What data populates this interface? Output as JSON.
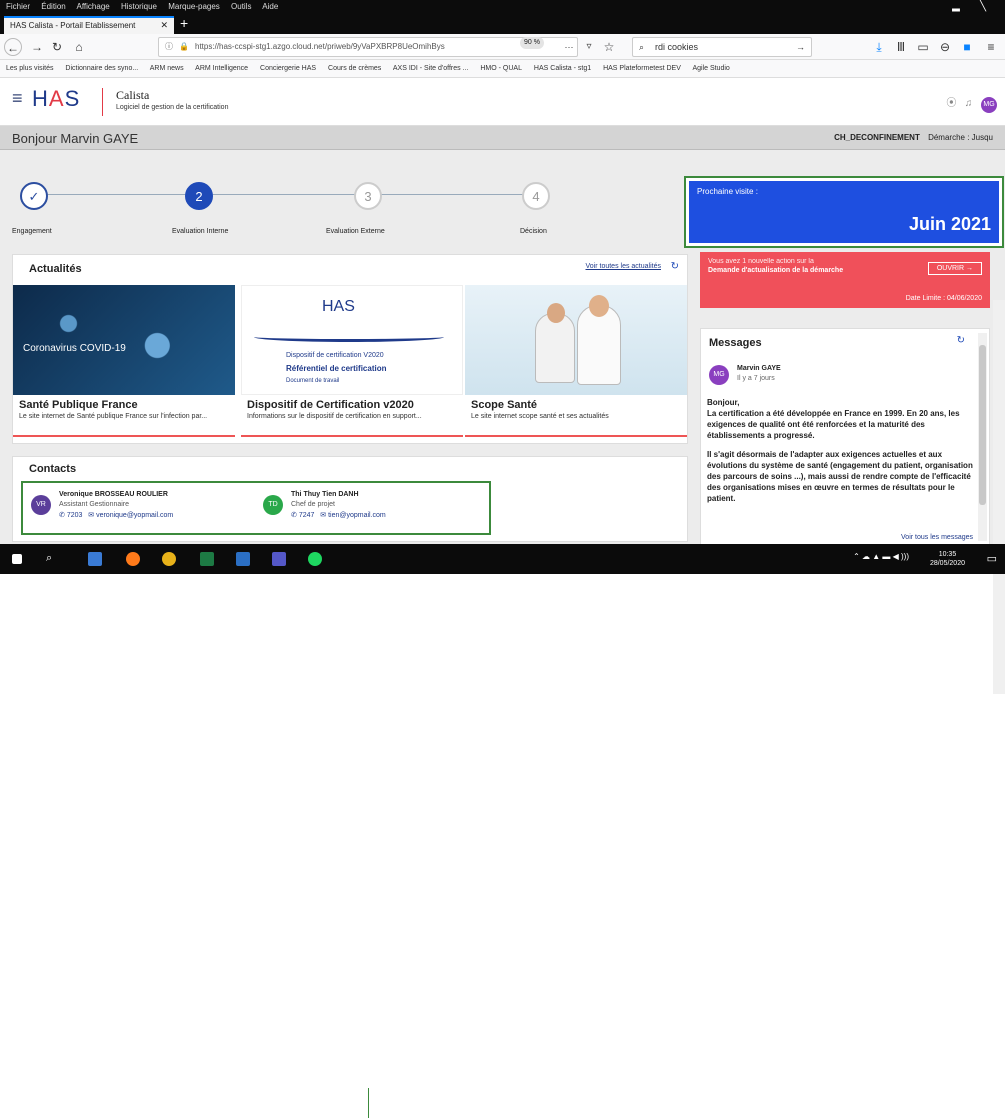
{
  "browser": {
    "menu": [
      "Fichier",
      "Édition",
      "Affichage",
      "Historique",
      "Marque-pages",
      "Outils",
      "Aide"
    ],
    "tab_title": "HAS Calista - Portail Etablissement",
    "tab_close": "✕",
    "new_tab": "+",
    "url": "https://has-ccspi-stg1.azgo.cloud.net/priweb/9yVaPXBRP8UeOmihBys",
    "zoom": "90 %",
    "search_value": "rdi cookies",
    "bookmarks": [
      "Les plus visités",
      "Dictionnaire des syno...",
      "ARM news",
      "ARM Intelligence",
      "Conciergerie HAS",
      "Cours de crèmes",
      "AXS IDI - Site d'offres ...",
      "HMO - QUAL",
      "HAS Calista - stg1",
      "HAS Plateformetest DEV",
      "Agile Studio"
    ]
  },
  "app": {
    "logo_h": "H",
    "logo_a": "A",
    "logo_s": "S",
    "name": "Calista",
    "subtitle": "Logiciel de gestion de la certification",
    "user_initials": "MG"
  },
  "greeting": {
    "text": "Bonjour Marvin GAYE",
    "establishment": "CH_DECONFINEMENT",
    "demarche": "Démarche : Jusqu"
  },
  "steps": [
    {
      "number": "✓",
      "label": "Engagement",
      "state": "done"
    },
    {
      "number": "2",
      "label": "Evaluation Interne",
      "state": "current"
    },
    {
      "number": "3",
      "label": "Evaluation Externe",
      "state": "todo"
    },
    {
      "number": "4",
      "label": "Décision",
      "state": "todo"
    }
  ],
  "next_visit": {
    "label": "Prochaine visite :",
    "date": "Juin 2021"
  },
  "alert": {
    "line1": "Vous avez 1 nouvelle action sur la",
    "line2": "Demande d'actualisation de la démarche",
    "button": "OUVRIR →",
    "deadline": "Date Limite : 04/06/2020"
  },
  "news": {
    "title": "Actualités",
    "see_all": "Voir toutes les actualités",
    "refresh": "↻",
    "items": [
      {
        "title": "Santé Publique France",
        "desc": "Le site internet de Santé publique France sur l'infection par...",
        "image_text": "Coronavirus COVID-19"
      },
      {
        "title": "Dispositif de Certification v2020",
        "desc": "Informations sur le dispositif de certification en support...",
        "image_text": "HAS",
        "image_p1": "Dispositif de certification V2020",
        "image_p2": "Référentiel de certification",
        "image_p3": "Document de travail"
      },
      {
        "title": "Scope Santé",
        "desc": "Le site internet scope santé et ses actualités",
        "image_text": "Scope Santé"
      }
    ]
  },
  "contacts": {
    "title": "Contacts",
    "items": [
      {
        "initials": "VR",
        "name": "Veronique BROSSEAU ROULIER",
        "role": "Assistant Gestionnaire",
        "phone": "7203",
        "email": "veronique@yopmail.com",
        "color": "#5b3e9a"
      },
      {
        "initials": "TD",
        "name": "Thi Thuy Tien DANH",
        "role": "Chef de projet",
        "phone": "7247",
        "email": "tien@yopmail.com",
        "color": "#2aa84a"
      }
    ]
  },
  "messages": {
    "title": "Messages",
    "refresh": "↻",
    "from_initials": "MG",
    "from": "Marvin GAYE",
    "ago": "Il y a 7 jours",
    "body": [
      "Bonjour,",
      "La certification a été développée en France en 1999. En 20 ans, les exigences de qualité ont été renforcées et la maturité des établissements a progressé.",
      "Il s'agit désormais de l'adapter aux exigences actuelles et aux évolutions du système de santé (engagement du patient, organisation des parcours de soins ...), mais aussi de rendre compte de l'efficacité des organisations mises en œuvre en termes de résultats pour le patient."
    ],
    "see_all": "Voir tous les messages"
  },
  "taskbar": {
    "time": "10:35",
    "date": "28/05/2020"
  }
}
